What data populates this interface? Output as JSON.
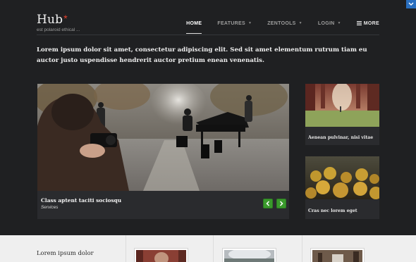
{
  "site": {
    "title": "Hub",
    "star": "*",
    "tagline": "est polaroid ethical ..."
  },
  "nav": {
    "items": [
      {
        "label": "HOME",
        "active": true,
        "dropdown": false
      },
      {
        "label": "FEATURES",
        "active": false,
        "dropdown": true
      },
      {
        "label": "ZENTOOLS",
        "active": false,
        "dropdown": true
      },
      {
        "label": "LOGIN",
        "active": false,
        "dropdown": true
      }
    ],
    "more_label": "MORE"
  },
  "intro": {
    "text": "Lorem ipsum dolor sit amet, consectetur adipiscing elit. Sed sit amet elementum rutrum tiam eu auctor justo uspendisse hendrerit auctor pretium enean venenatis."
  },
  "slider": {
    "caption_title": "Class aptent taciti sociosqu",
    "caption_subtitle": "Services"
  },
  "cards": [
    {
      "text": "Aenean pulvinar, nisi vitae"
    },
    {
      "text": "Cras nec lorem eget"
    }
  ],
  "bottom": {
    "heading": "Lorem ipsum dolor"
  },
  "colors": {
    "background": "#1f2022",
    "panel": "#2a2b2e",
    "accent_red": "#e5412d",
    "arrow_green": "#3a9a2c",
    "badge_blue": "#2a6fbf",
    "bottom_band": "#efefef"
  },
  "icons": {
    "corner": "chevron-down-icon",
    "more": "menu-icon",
    "slider_prev": "chevron-left-icon",
    "slider_next": "chevron-right-icon",
    "nav_dropdown": "caret-down-icon"
  }
}
